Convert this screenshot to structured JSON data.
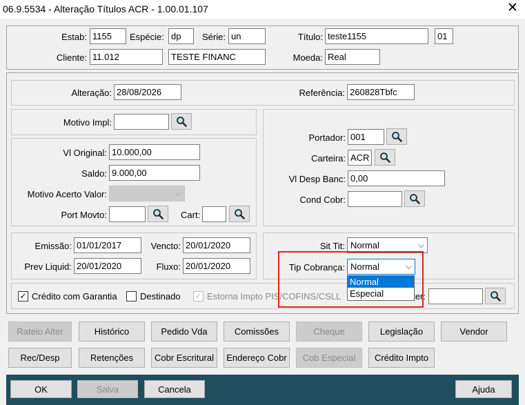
{
  "window": {
    "title": "06.9.5534 - Alteração Títulos ACR - 1.00.01.107"
  },
  "header": {
    "estab_label": "Estab:",
    "estab_value": "1155",
    "especie_label": "Espécie:",
    "especie_value": "dp",
    "serie_label": "Série:",
    "serie_value": "un",
    "titulo_label": "Título:",
    "titulo_value": "teste1155",
    "parcela_value": "01",
    "cliente_label": "Cliente:",
    "cliente_value": "11.012",
    "cliente_nome": "TESTE FINANC",
    "moeda_label": "Moeda:",
    "moeda_value": "Real"
  },
  "alteracao": {
    "label": "Alteração:",
    "value": "28/08/2026",
    "referencia_label": "Referência:",
    "referencia_value": "260828Tbfc"
  },
  "motivo": {
    "label": "Motivo Impl:",
    "value": ""
  },
  "valores": {
    "vl_original_label": "Vl Original:",
    "vl_original_value": "10.000,00",
    "saldo_label": "Saldo:",
    "saldo_value": "9.000,00",
    "motivo_acerto_label": "Motivo Acerto Valor:",
    "motivo_acerto_value": "",
    "port_movto_label": "Port Movto:",
    "port_movto_value": "",
    "cart_label": "Cart:",
    "cart_value": ""
  },
  "cobranca": {
    "portador_label": "Portador:",
    "portador_value": "001",
    "carteira_label": "Carteira:",
    "carteira_value": "ACR",
    "vl_desp_banc_label": "Vl Desp Banc:",
    "vl_desp_banc_value": "0,00",
    "cond_cobr_label": "Cond Cobr:",
    "cond_cobr_value": ""
  },
  "datas": {
    "emissao_label": "Emissão:",
    "emissao_value": "01/01/2017",
    "vencto_label": "Vencto:",
    "vencto_value": "20/01/2020",
    "prev_liquid_label": "Prev Liquid:",
    "prev_liquid_value": "20/01/2020",
    "fluxo_label": "Fluxo:",
    "fluxo_value": "20/01/2020"
  },
  "situacao": {
    "sit_tit_label": "Sit Tit:",
    "sit_tit_value": "Normal",
    "tip_cobranca_label": "Tip Cobrança:",
    "tip_cobranca_value": "Normal",
    "tip_cobranca_options": [
      "Normal",
      "Especial"
    ]
  },
  "checks": {
    "credito_garantia_label": "Crédito com Garantia",
    "destinado_label": "Destinado",
    "estorna_label": "Estorna Impto PIS/COFINS/CSLL",
    "motivo_alter_label": "Motivo Alter:",
    "motivo_alter_value": ""
  },
  "buttons_row1": [
    "Rateio Alter",
    "Histórico",
    "Pedido Vda",
    "Comissões",
    "Cheque",
    "Legislação",
    "Vendor"
  ],
  "buttons_row2": [
    "Rec/Desp",
    "Retenções",
    "Cobr Escritural",
    "Endereço Cobr",
    "Cob Especial",
    "Crédito Impto"
  ],
  "footer": {
    "ok": "OK",
    "salva": "Salva",
    "cancela": "Cancela",
    "ajuda": "Ajuda"
  },
  "colors": {
    "footer_bg": "#1f4e5f",
    "highlight": "#e02020",
    "selection": "#0078d7"
  }
}
